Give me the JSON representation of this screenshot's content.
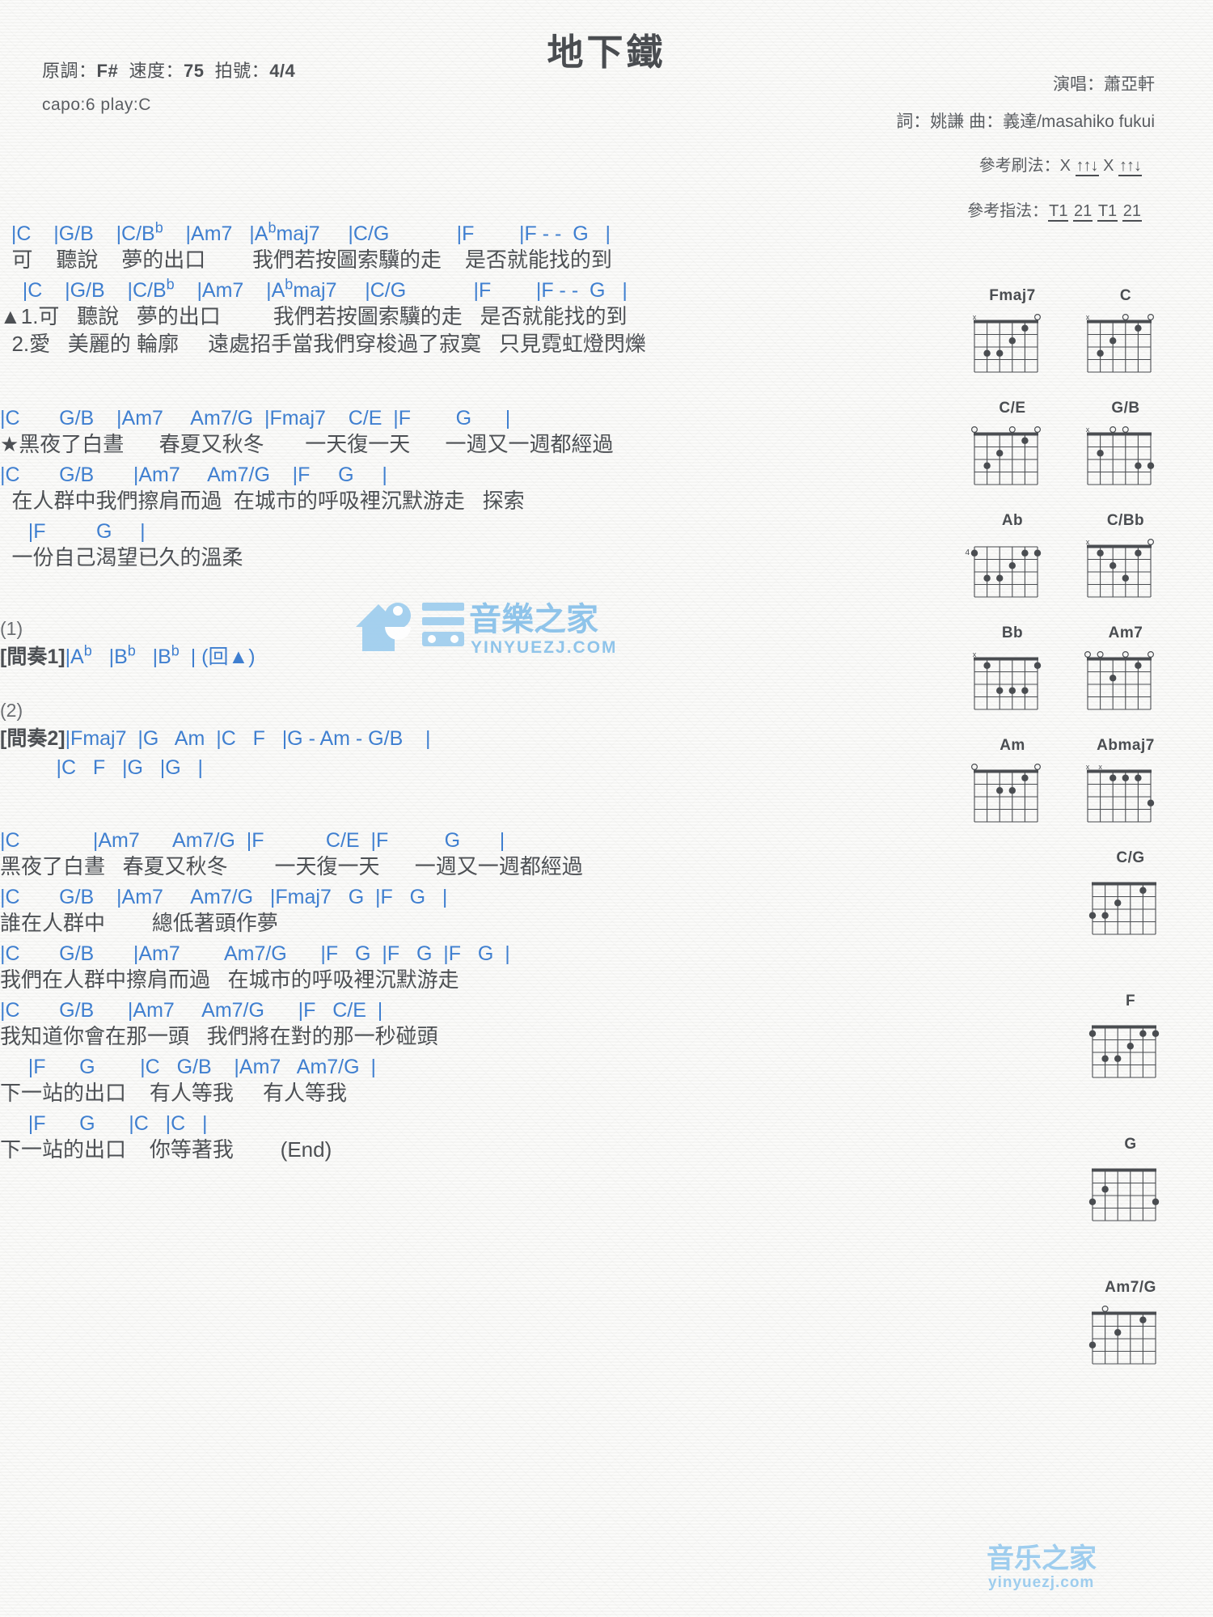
{
  "header": {
    "title": "地下鐵",
    "key_label": "原調：",
    "key_value": "F#",
    "tempo_label": "速度：",
    "tempo_value": "75",
    "time_label": "拍號：",
    "time_value": "4/4",
    "capo": "capo:6 play:C",
    "singer": "演唱：蕭亞軒",
    "credits": "詞：姚謙  曲：義達/masahiko fukui",
    "strum_label": "參考刷法：",
    "strum_pattern": "X ↑↑↓ X ↑↑↓",
    "strum_tokens": [
      "X",
      "↑↑↓",
      "X",
      "↑↑↓"
    ],
    "fingerstyle_label": "參考指法：",
    "fingerstyle_pattern": "T1 21 T1 21",
    "fingerstyle_tokens": [
      "T1",
      "21",
      "T1",
      "21"
    ]
  },
  "accent_color": "#3f7fd0",
  "text_color": "#4d5054",
  "song": [
    {
      "type": "chord",
      "text": "  |C    |G/B    |C/B♭    |Am7   |A♭maj7     |C/G            |F        |F - -  G   |"
    },
    {
      "type": "lyric",
      "text": "  可    聽說    夢的出口        我們若按圖索驥的走    是否就能找的到"
    },
    {
      "type": "chord",
      "text": "    |C    |G/B    |C/B♭    |Am7    |A♭maj7     |C/G            |F        |F - -  G   |"
    },
    {
      "type": "lyric",
      "text": "▲1.可   聽說   夢的出口         我們若按圖索驥的走   是否就能找的到"
    },
    {
      "type": "lyric",
      "text": "  2.愛   美麗的 輪廓     遠處招手當我們穿梭過了寂寞   只見霓虹燈閃爍"
    },
    {
      "type": "gap",
      "size": "lg"
    },
    {
      "type": "chord",
      "text": "|C       G/B    |Am7     Am7/G  |Fmaj7    C/E  |F        G      |"
    },
    {
      "type": "lyric",
      "text": "★黑夜了白晝      春夏又秋冬       一天復一天      一週又一週都經過"
    },
    {
      "type": "chord",
      "text": "|C       G/B       |Am7     Am7/G    |F     G     |"
    },
    {
      "type": "lyric",
      "text": "  在人群中我們擦肩而過  在城市的呼吸裡沉默游走   探索"
    },
    {
      "type": "chord",
      "text": "     |F         G     |"
    },
    {
      "type": "lyric",
      "text": "  一份自己渴望已久的溫柔"
    },
    {
      "type": "gap",
      "size": "lg"
    },
    {
      "type": "paren",
      "text": "(1)"
    },
    {
      "type": "interlude1",
      "label": "[間奏1]",
      "chords": "|A♭   |B♭   |B♭  | (回▲)"
    },
    {
      "type": "gap",
      "size": "md"
    },
    {
      "type": "paren",
      "text": "(2)"
    },
    {
      "type": "interlude2",
      "label": "[間奏2]",
      "chords": "|Fmaj7  |G   Am  |C   F   |G - Am - G/B    |"
    },
    {
      "type": "chord",
      "text": "          |C   F   |G   |G   |"
    },
    {
      "type": "gap",
      "size": "lg"
    },
    {
      "type": "chord",
      "text": "|C             |Am7      Am7/G  |F           C/E  |F          G       |"
    },
    {
      "type": "lyric",
      "text": "黑夜了白晝   春夏又秋冬        一天復一天      一週又一週都經過"
    },
    {
      "type": "chord",
      "text": "|C       G/B    |Am7     Am7/G   |Fmaj7   G  |F   G   |"
    },
    {
      "type": "lyric",
      "text": "誰在人群中        總低著頭作夢"
    },
    {
      "type": "chord",
      "text": "|C       G/B       |Am7        Am7/G      |F   G  |F   G  |F   G  |"
    },
    {
      "type": "lyric",
      "text": "我們在人群中擦肩而過   在城市的呼吸裡沉默游走"
    },
    {
      "type": "chord",
      "text": "|C       G/B      |Am7     Am7/G      |F   C/E  |"
    },
    {
      "type": "lyric",
      "text": "我知道你會在那一頭   我們將在對的那一秒碰頭"
    },
    {
      "type": "chord",
      "text": "     |F      G        |C   G/B    |Am7   Am7/G  |"
    },
    {
      "type": "lyric",
      "text": "下一站的出口    有人等我     有人等我"
    },
    {
      "type": "chord",
      "text": "     |F      G      |C   |C   |"
    },
    {
      "type": "lyric",
      "text": "下一站的出口    你等著我        (End)"
    }
  ],
  "chord_diagrams": [
    {
      "name": "Fmaj7",
      "baseFret": 1,
      "label": "",
      "frets": [
        -1,
        3,
        3,
        2,
        1,
        0
      ],
      "open": [
        5
      ],
      "muted": [
        0
      ]
    },
    {
      "name": "C",
      "baseFret": 1,
      "label": "",
      "frets": [
        -1,
        3,
        2,
        0,
        1,
        0
      ],
      "open": [
        3,
        5
      ],
      "muted": [
        0
      ]
    },
    {
      "name": "C/E",
      "baseFret": 1,
      "label": "",
      "frets": [
        0,
        3,
        2,
        0,
        1,
        0
      ],
      "open": [
        0,
        3,
        5
      ],
      "muted": []
    },
    {
      "name": "G/B",
      "baseFret": 1,
      "label": "",
      "frets": [
        -1,
        2,
        0,
        0,
        3,
        3
      ],
      "open": [
        2,
        3
      ],
      "muted": [
        0
      ]
    },
    {
      "name": "Ab",
      "baseFret": 4,
      "label": "4",
      "frets": [
        1,
        3,
        3,
        2,
        1,
        1
      ],
      "open": [],
      "muted": []
    },
    {
      "name": "C/Bb",
      "baseFret": 1,
      "label": "",
      "frets": [
        -1,
        1,
        2,
        3,
        1,
        0
      ],
      "open": [
        5
      ],
      "muted": [
        0
      ]
    },
    {
      "name": "Bb",
      "baseFret": 1,
      "label": "",
      "frets": [
        -1,
        1,
        3,
        3,
        3,
        1
      ],
      "open": [],
      "muted": [
        0
      ]
    },
    {
      "name": "Am7",
      "baseFret": 1,
      "label": "",
      "frets": [
        0,
        0,
        2,
        0,
        1,
        0
      ],
      "open": [
        0,
        1,
        3,
        5
      ],
      "muted": []
    },
    {
      "name": "Am",
      "baseFret": 1,
      "label": "",
      "frets": [
        0,
        0,
        2,
        2,
        1,
        0
      ],
      "open": [
        0,
        5
      ],
      "muted": []
    },
    {
      "name": "Abmaj7",
      "baseFret": 1,
      "label": "",
      "frets": [
        -1,
        -1,
        1,
        1,
        1,
        3
      ],
      "open": [],
      "muted": [
        0,
        1
      ]
    },
    {
      "name": "C/G",
      "baseFret": 1,
      "label": "",
      "frets": [
        3,
        3,
        2,
        0,
        1,
        0
      ],
      "open": [],
      "muted": []
    },
    {
      "name": "F",
      "baseFret": 1,
      "label": "",
      "frets": [
        1,
        3,
        3,
        2,
        1,
        1
      ],
      "open": [],
      "muted": []
    },
    {
      "name": "G",
      "baseFret": 1,
      "label": "",
      "frets": [
        3,
        2,
        0,
        0,
        0,
        3
      ],
      "open": [],
      "muted": []
    },
    {
      "name": "Am7/G",
      "baseFret": 1,
      "label": "",
      "frets": [
        3,
        0,
        2,
        0,
        1,
        0
      ],
      "open": [
        1
      ],
      "muted": []
    }
  ],
  "watermark": {
    "text": "音樂之家",
    "sub": "YINYUEZJ.COM",
    "text2": "音乐之家",
    "sub2": "yinyuezj.com"
  }
}
